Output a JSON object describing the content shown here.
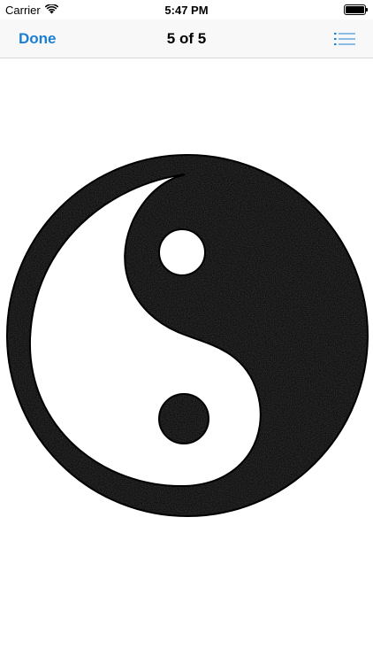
{
  "status_bar": {
    "carrier": "Carrier",
    "time": "5:47 PM",
    "icons": [
      "wifi-icon",
      "battery-icon"
    ]
  },
  "nav": {
    "done_label": "Done",
    "title": "5 of 5",
    "menu_icon": "list-icon"
  },
  "content": {
    "image": "yin-yang-symbol"
  },
  "colors": {
    "accent": "#1a7fd4",
    "texture_dark": "#2b2b2b",
    "texture_light": "#9a9a9a",
    "outline": "#000000",
    "nav_background": "#f8f8f8"
  }
}
